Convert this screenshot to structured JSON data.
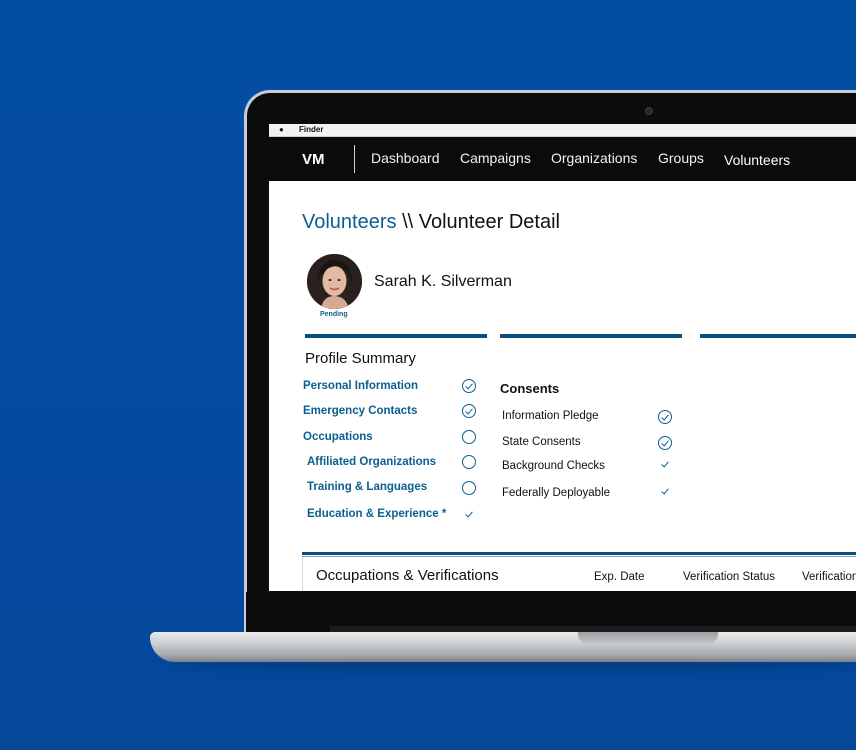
{
  "menubar": {
    "app_name": "Finder"
  },
  "nav": {
    "logo": "VM",
    "items": [
      "Dashboard",
      "Campaigns",
      "Organizations",
      "Groups",
      "Volunteers"
    ]
  },
  "breadcrumb": {
    "link": "Volunteers",
    "separator": " \\\\ ",
    "current": "Volunteer Detail"
  },
  "volunteer": {
    "name": "Sarah K. Silverman",
    "status": "Pending"
  },
  "profile_summary": {
    "title": "Profile Summary",
    "items": [
      {
        "label": "Personal Information",
        "state": "complete"
      },
      {
        "label": "Emergency Contacts",
        "state": "complete"
      },
      {
        "label": "Occupations",
        "state": "empty"
      },
      {
        "label": "Affiliated Organizations",
        "state": "empty"
      },
      {
        "label": "Training & Languages",
        "state": "empty"
      },
      {
        "label": "Education & Experience *",
        "state": "checked"
      }
    ]
  },
  "consents": {
    "title": "Consents",
    "items": [
      {
        "label": "Information Pledge",
        "state": "complete"
      },
      {
        "label": "State Consents",
        "state": "complete"
      },
      {
        "label": "Background Checks",
        "state": "checked"
      },
      {
        "label": "Federally Deployable",
        "state": "checked"
      }
    ]
  },
  "occupations": {
    "title": "Occupations & Verifications",
    "columns": [
      "Exp. Date",
      "Verification Status",
      "Verification"
    ]
  },
  "colors": {
    "accent": "#0b5f8f",
    "nav_bg": "#0b0b0b",
    "background": "#044a9e"
  }
}
